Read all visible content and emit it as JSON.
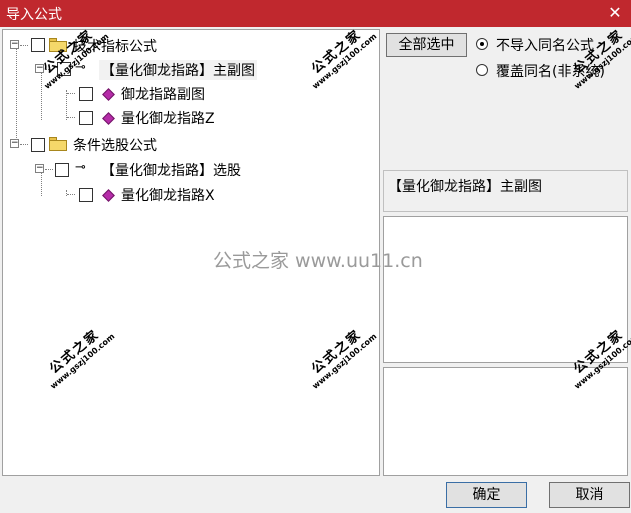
{
  "window": {
    "title": "导入公式"
  },
  "tree": {
    "nodes": [
      {
        "label": "技术指标公式",
        "type": "folder"
      },
      {
        "label": "【量化御龙指路】主副图",
        "type": "key"
      },
      {
        "label": "御龙指路副图",
        "type": "formula"
      },
      {
        "label": "量化御龙指路Z",
        "type": "formula"
      },
      {
        "label": "条件选股公式",
        "type": "folder"
      },
      {
        "label": "【量化御龙指路】选股",
        "type": "key"
      },
      {
        "label": "量化御龙指路X",
        "type": "formula"
      }
    ]
  },
  "options": {
    "select_all_label": "全部选中",
    "radio_skip_label": "不导入同名公式",
    "radio_overwrite_label": "覆盖同名(非系统)",
    "selected_radio": "skip"
  },
  "info": {
    "selected_name": "【量化御龙指路】主副图"
  },
  "footer": {
    "ok_label": "确定",
    "cancel_label": "取消"
  },
  "watermarks": {
    "brand": "公式之家",
    "site": "www.gszj100.com",
    "center_text": "公式之家 www.uu11.cn"
  }
}
